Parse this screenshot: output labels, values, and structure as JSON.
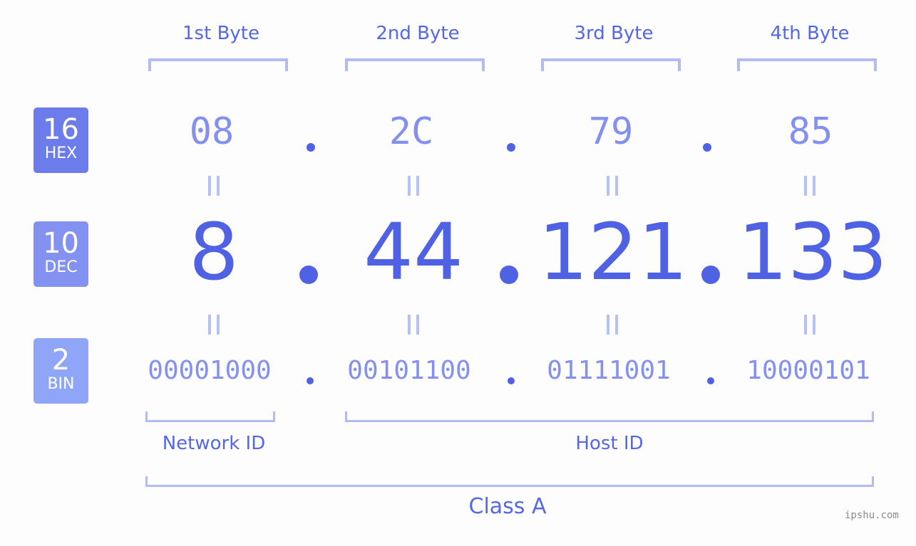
{
  "badges": [
    {
      "num": "16",
      "label": "HEX",
      "color": "#6d7ceb"
    },
    {
      "num": "10",
      "label": "DEC",
      "color": "#8391f1"
    },
    {
      "num": "2",
      "label": "BIN",
      "color": "#8fa6f8"
    }
  ],
  "bytes": [
    {
      "label": "1st Byte",
      "hex": "08",
      "dec": "8",
      "bin": "00001000"
    },
    {
      "label": "2nd Byte",
      "hex": "2C",
      "dec": "44",
      "bin": "00101100"
    },
    {
      "label": "3rd Byte",
      "hex": "79",
      "dec": "121",
      "bin": "01111001"
    },
    {
      "label": "4th Byte",
      "hex": "85",
      "dec": "133",
      "bin": "10000101"
    }
  ],
  "ip_address": "8.44.121.133",
  "network_id_label": "Network ID",
  "host_id_label": "Host ID",
  "class_label": "Class A",
  "watermark": "ipshu.com"
}
